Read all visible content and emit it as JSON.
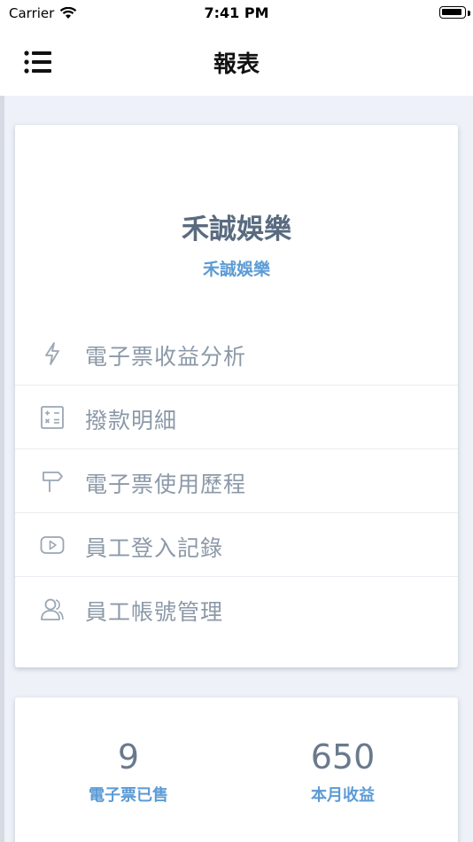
{
  "status_bar": {
    "carrier": "Carrier",
    "time": "7:41 PM"
  },
  "nav": {
    "title": "報表",
    "menu_icon": "hamburger-menu-icon"
  },
  "company": {
    "name": "禾誠娛樂",
    "subtitle": "禾誠娛樂"
  },
  "menu": [
    {
      "label": "電子票收益分析",
      "icon": "lightning-icon"
    },
    {
      "label": "撥款明細",
      "icon": "calculator-icon"
    },
    {
      "label": "電子票使用歷程",
      "icon": "signpost-icon"
    },
    {
      "label": "員工登入記錄",
      "icon": "video-play-icon"
    },
    {
      "label": "員工帳號管理",
      "icon": "users-icon"
    }
  ],
  "stats": {
    "tickets_sold_value": "9",
    "tickets_sold_label": "電子票已售",
    "monthly_revenue_value": "650",
    "monthly_revenue_label": "本月收益"
  },
  "colors": {
    "accent": "#5c9bd5",
    "text_muted": "#8c99a8",
    "title": "#5a6b80",
    "background": "#eef1f8"
  }
}
